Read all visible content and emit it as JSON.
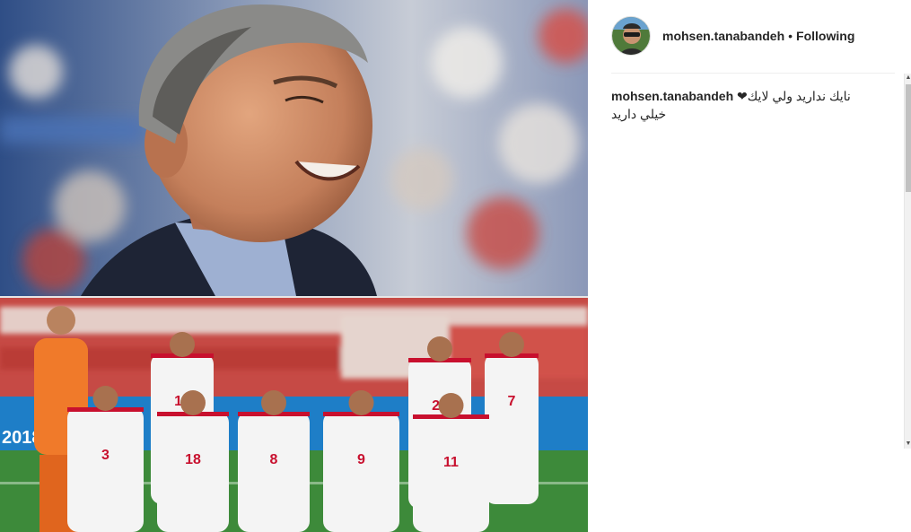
{
  "post": {
    "username": "mohsen.tanabandeh",
    "separator": "•",
    "follow_status": "Following",
    "caption_username": "mohsen.tanabandeh",
    "caption_line1": "نايك نداريد ولي لايك❤",
    "caption_line2": "خيلي داريد"
  },
  "media": {
    "top_image": "coach-portrait-photo",
    "bottom_image": "team-lineup-photo",
    "banner_text": "2018",
    "jersey_numbers": [
      "10",
      "7",
      "23",
      "3",
      "18",
      "8",
      "9",
      "11"
    ]
  },
  "colors": {
    "text": "#262626",
    "divider": "#efefef",
    "jersey": "#f4f4f4",
    "jersey_trim": "#c8102e",
    "keeper": "#f07a2a",
    "pitch": "#3d8a3a"
  }
}
